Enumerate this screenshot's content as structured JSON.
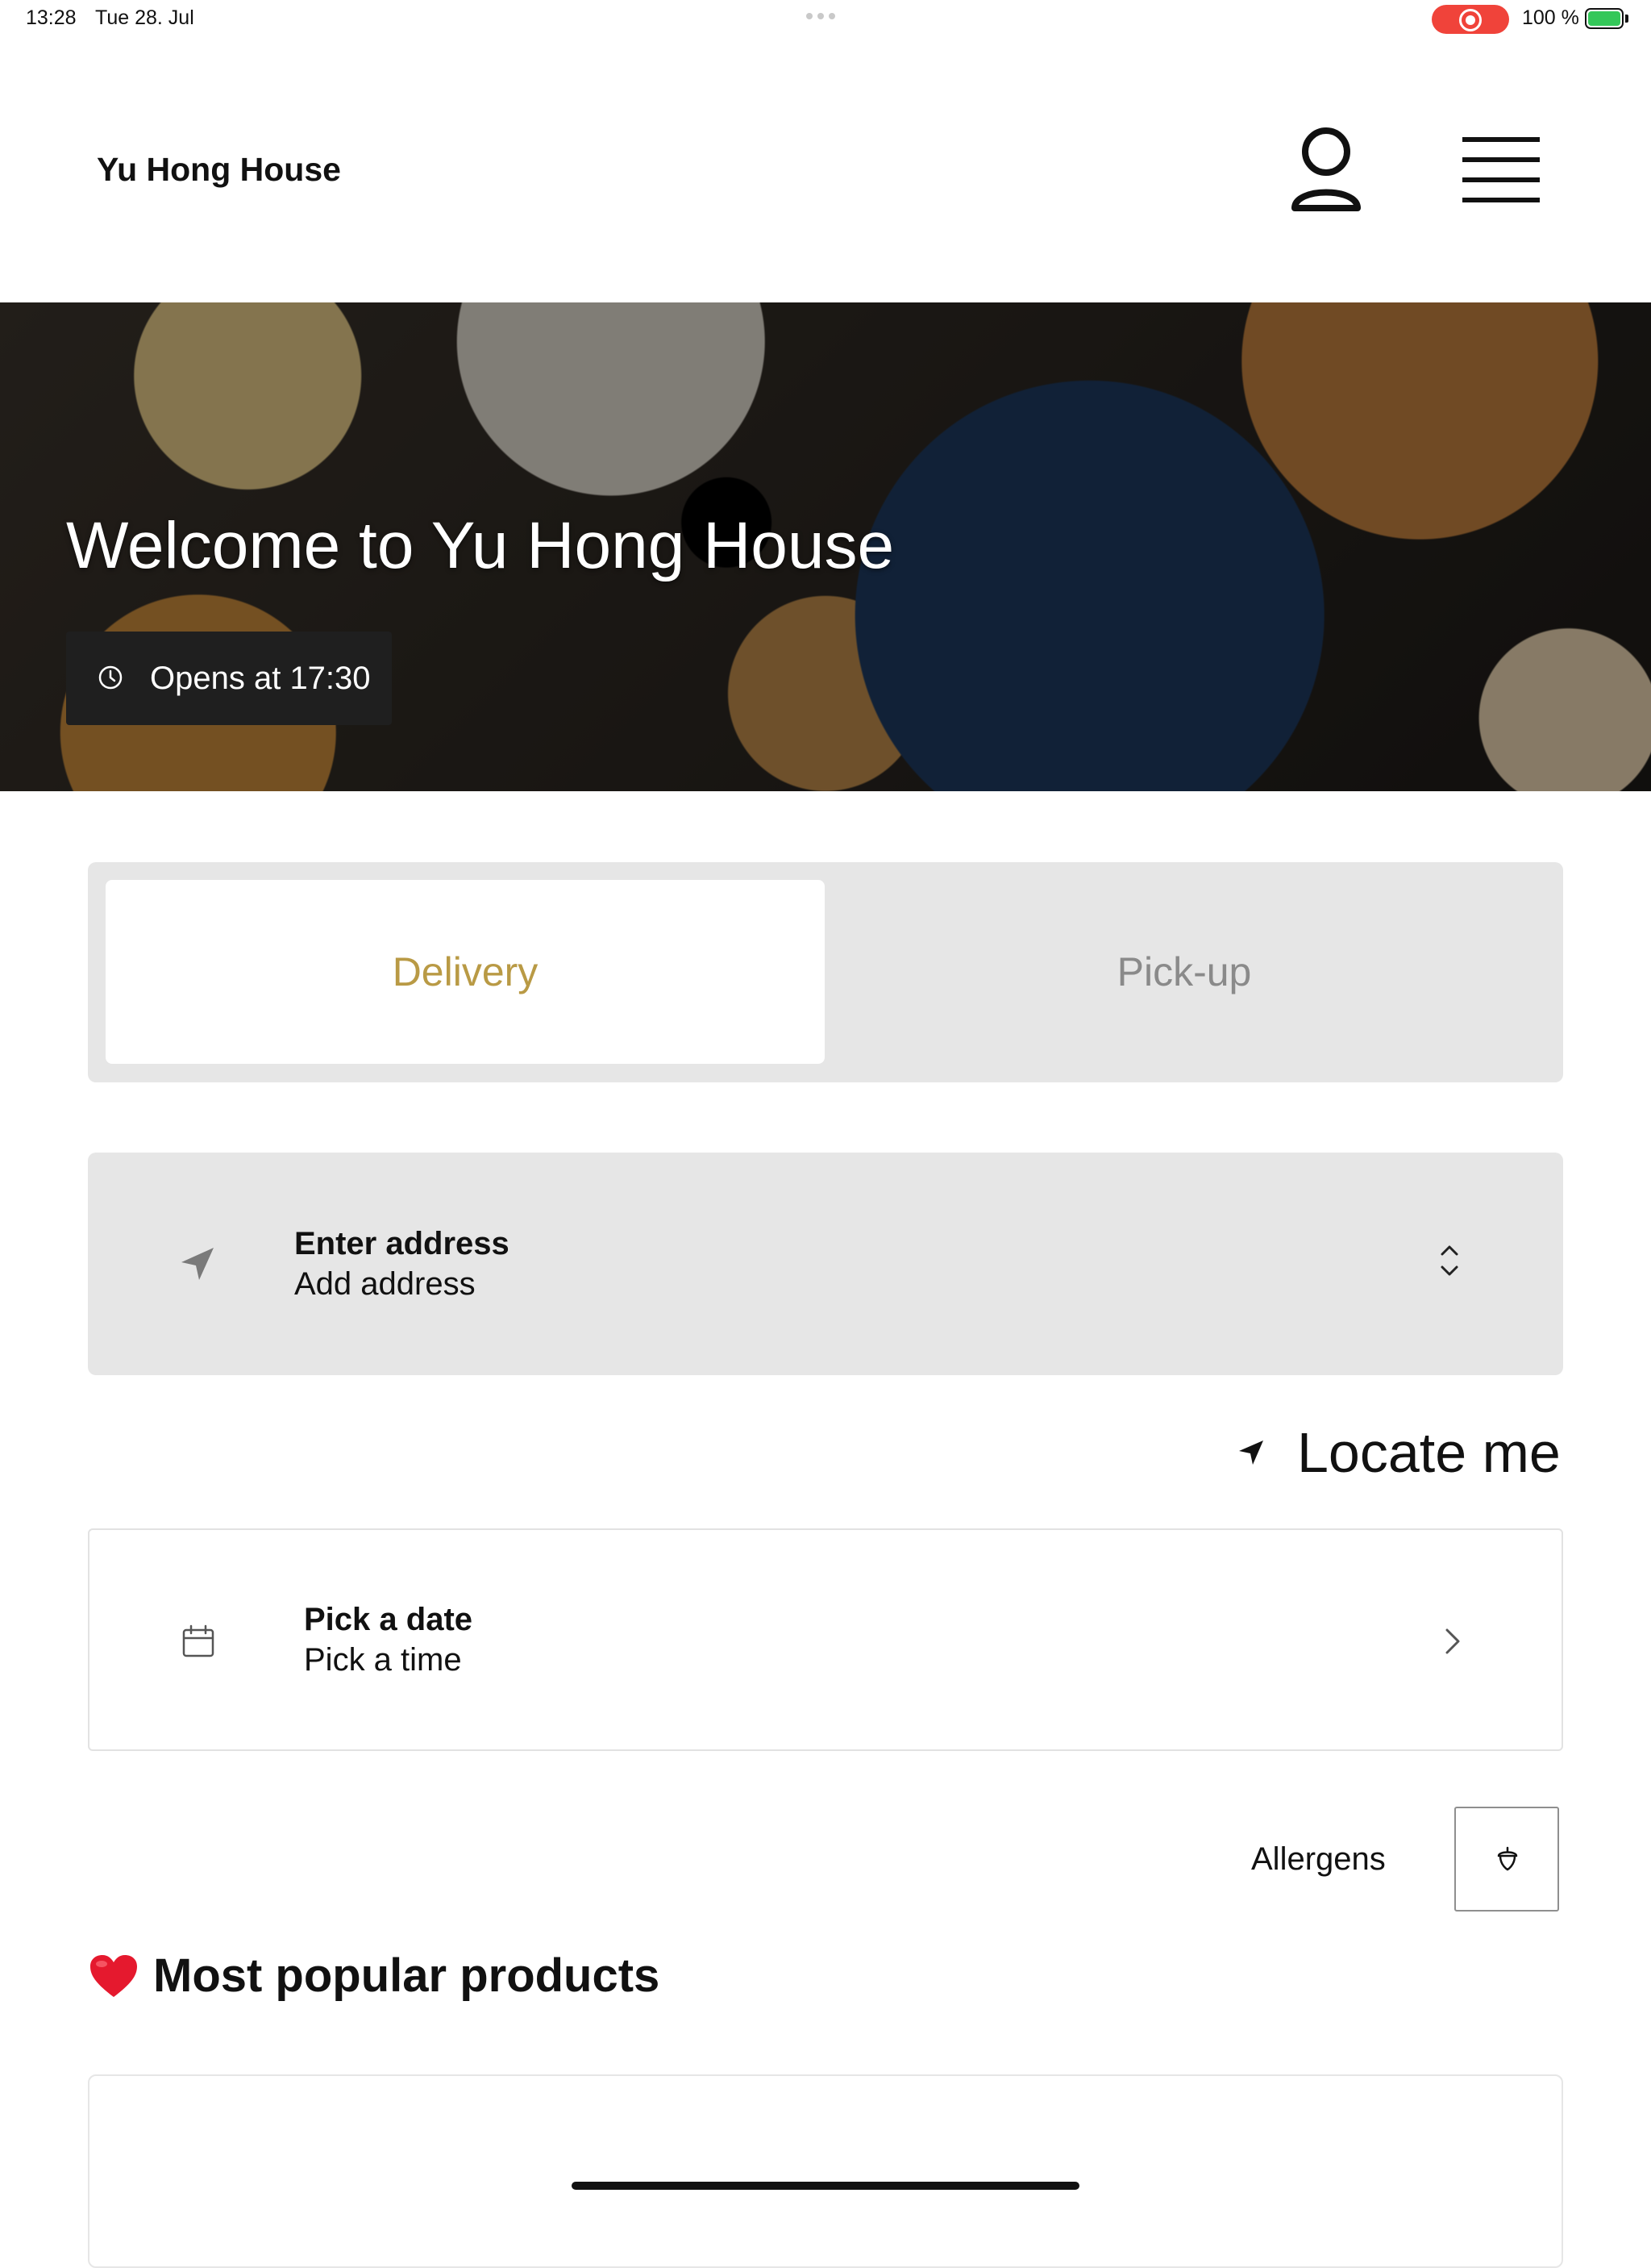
{
  "status_bar": {
    "time": "13:28",
    "date": "Tue 28. Jul",
    "battery": "100 %"
  },
  "header": {
    "brand": "Yu Hong House",
    "icons": [
      "user-icon",
      "menu-icon"
    ]
  },
  "hero": {
    "title": "Welcome to Yu Hong House",
    "opens": "Opens at 17:30"
  },
  "tabs": [
    {
      "label": "Delivery",
      "active": true
    },
    {
      "label": "Pick-up",
      "active": false
    }
  ],
  "address": {
    "title": "Enter address",
    "subtitle": "Add address"
  },
  "locate": {
    "label": "Locate me"
  },
  "schedule": {
    "title": "Pick a date",
    "subtitle": "Pick a time"
  },
  "allergens": {
    "label": "Allergens"
  },
  "popular": {
    "title": "Most popular products"
  },
  "colors": {
    "accent": "#b99a45",
    "panel": "#e6e6e6",
    "record": "#f0433a",
    "battery": "#34c759"
  }
}
